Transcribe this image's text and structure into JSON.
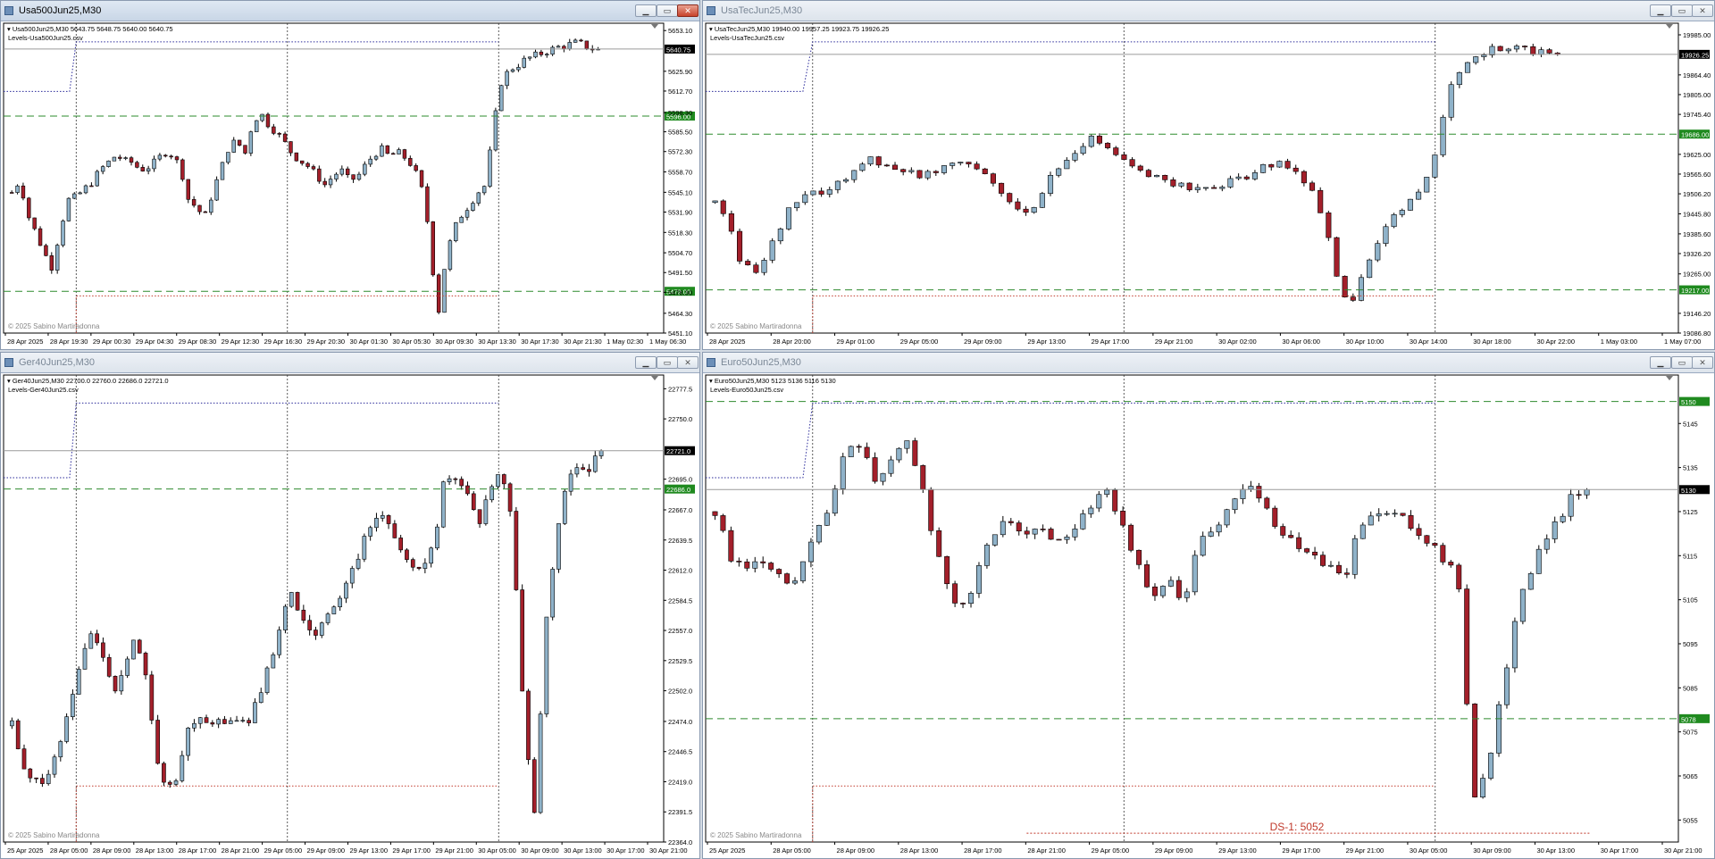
{
  "windows": [
    {
      "title": "Usa500Jun25,M30",
      "active": true,
      "info": "Usa500Jun25,M30  5643.75 5648.75 5640.00 5640.75",
      "indicator": "Levels-Usa500Jun25.csv",
      "copyright": "© 2025 Sabino Martiradonna",
      "buttons": [
        "▁",
        "▭",
        "✕"
      ]
    },
    {
      "title": "UsaTecJun25,M30",
      "active": false,
      "info": "UsaTecJun25,M30  19940.00 19957.25 19923.75 19926.25",
      "indicator": "Levels-UsaTecJun25.csv",
      "copyright": "© 2025 Sabino Martiradonna",
      "buttons": [
        "▁",
        "▭",
        "✕"
      ]
    },
    {
      "title": "Ger40Jun25,M30",
      "active": false,
      "info": "Ger40Jun25,M30  22700.0 22760.0 22686.0 22721.0",
      "indicator": "Levels-Ger40Jun25.csv",
      "copyright": "© 2025 Sabino Martiradonna",
      "buttons": [
        "▁",
        "▭",
        "✕"
      ]
    },
    {
      "title": "Euro50Jun25,M30",
      "active": false,
      "info": "Euro50Jun25,M30  5123 5136 5116 5130",
      "indicator": "Levels-Euro50Jun25.csv",
      "copyright": "© 2025 Sabino Martiradonna",
      "buttons": [
        "▁",
        "▭",
        "✕"
      ]
    }
  ],
  "colors": {
    "bull_fill": "#8fb2c9",
    "bear_fill": "#a31f2a",
    "candle_outline": "#000000",
    "level_line": "#2e8b2e",
    "level_label_bg": "#1f8a1f",
    "price_label_bg": "#000000",
    "grid_sep": "#333333",
    "bid_line": "#9a9a9a",
    "ds_line": "#c0392b",
    "blue_dotted": "#2a2a9a"
  },
  "chart_data": [
    {
      "type": "candlestick",
      "symbol": "Usa500Jun25",
      "timeframe": "M30",
      "ylim": [
        5451.1,
        5658.0
      ],
      "y_ticks": [
        "5653.10",
        "5640.75",
        "5625.90",
        "5612.70",
        "5598.30",
        "5585.50",
        "5572.30",
        "5558.70",
        "5545.10",
        "5531.90",
        "5518.30",
        "5504.70",
        "5491.50",
        "5478.30",
        "5464.30",
        "5451.10"
      ],
      "x_tick_labels": [
        "28 Apr 2025",
        "28 Apr 19:30",
        "29 Apr 00:30",
        "29 Apr 04:30",
        "29 Apr 08:30",
        "29 Apr 12:30",
        "29 Apr 16:30",
        "29 Apr 20:30",
        "30 Apr 01:30",
        "30 Apr 05:30",
        "30 Apr 09:30",
        "30 Apr 13:30",
        "30 Apr 17:30",
        "30 Apr 21:30",
        "1 May 02:30",
        "1 May 06:30"
      ],
      "current_price": "5640.75",
      "levels": [
        {
          "value": 5596.0,
          "label": "5596.00"
        },
        {
          "value": 5479.0,
          "label": "5479.00"
        }
      ],
      "n_candles": 104,
      "path": [
        5545,
        5553,
        5530,
        5518,
        5505,
        5495,
        5520,
        5540,
        5542,
        5547,
        5552,
        5560,
        5565,
        5570,
        5566,
        5565,
        5560,
        5562,
        5566,
        5572,
        5570,
        5562,
        5540,
        5535,
        5528,
        5545,
        5560,
        5575,
        5580,
        5570,
        5592,
        5598,
        5590,
        5585,
        5578,
        5570,
        5566,
        5562,
        5556,
        5550,
        5556,
        5560,
        5553,
        5555,
        5563,
        5570,
        5574,
        5569,
        5572,
        5568,
        5562,
        5548,
        5518,
        5460,
        5500,
        5520,
        5530,
        5537,
        5545,
        5550,
        5590,
        5620,
        5627,
        5630,
        5634,
        5636,
        5638,
        5640,
        5642,
        5643,
        5645,
        5644,
        5641,
        5640.75
      ],
      "xmax_frac": 0.905
    },
    {
      "type": "candlestick",
      "symbol": "UsaTecJun25",
      "timeframe": "M30",
      "ylim": [
        19086.8,
        20020.0
      ],
      "y_ticks": [
        "19985.00",
        "19926.25",
        "19864.40",
        "19805.00",
        "19745.40",
        "19686.00",
        "19625.00",
        "19565.60",
        "19506.20",
        "19445.80",
        "19385.60",
        "19326.20",
        "19265.00",
        "19217.00",
        "19146.20",
        "19086.80"
      ],
      "x_tick_labels": [
        "28 Apr 2025",
        "28 Apr 20:00",
        "29 Apr 01:00",
        "29 Apr 05:00",
        "29 Apr 09:00",
        "29 Apr 13:00",
        "29 Apr 17:00",
        "29 Apr 21:00",
        "30 Apr 02:00",
        "30 Apr 06:00",
        "30 Apr 10:00",
        "30 Apr 14:00",
        "30 Apr 18:00",
        "30 Apr 22:00",
        "1 May 03:00",
        "1 May 07:00"
      ],
      "current_price": "19926.25",
      "levels": [
        {
          "value": 19686.0,
          "label": "19686.00"
        },
        {
          "value": 19217.0,
          "label": "19217.00"
        }
      ],
      "n_candles": 104,
      "path": [
        19480,
        19430,
        19300,
        19270,
        19320,
        19400,
        19480,
        19510,
        19500,
        19530,
        19550,
        19590,
        19610,
        19600,
        19580,
        19570,
        19560,
        19580,
        19600,
        19610,
        19590,
        19560,
        19520,
        19470,
        19440,
        19500,
        19560,
        19600,
        19640,
        19670,
        19650,
        19620,
        19590,
        19570,
        19560,
        19545,
        19530,
        19520,
        19525,
        19530,
        19545,
        19560,
        19580,
        19590,
        19595,
        19570,
        19520,
        19420,
        19250,
        19150,
        19280,
        19340,
        19420,
        19460,
        19500,
        19560,
        19700,
        19860,
        19910,
        19930,
        19940,
        19945,
        19944,
        19935,
        19930,
        19926.25
      ],
      "xmax_frac": 0.88
    },
    {
      "type": "candlestick",
      "symbol": "Ger40Jun25",
      "timeframe": "M30",
      "ylim": [
        22364.0,
        22790.0
      ],
      "y_ticks": [
        "22777.5",
        "22750.0",
        "22721.0",
        "22695.0",
        "22686.0",
        "22667.0",
        "22639.5",
        "22612.0",
        "22584.5",
        "22557.0",
        "22529.5",
        "22502.0",
        "22474.0",
        "22446.5",
        "22419.0",
        "22391.5",
        "22364.0"
      ],
      "x_tick_labels": [
        "25 Apr 2025",
        "28 Apr 05:00",
        "28 Apr 09:00",
        "28 Apr 13:00",
        "28 Apr 17:00",
        "28 Apr 21:00",
        "29 Apr 05:00",
        "29 Apr 09:00",
        "29 Apr 13:00",
        "29 Apr 17:00",
        "29 Apr 21:00",
        "30 Apr 05:00",
        "30 Apr 09:00",
        "30 Apr 13:00",
        "30 Apr 17:00",
        "30 Apr 21:00"
      ],
      "current_price": "22721.0",
      "levels": [
        {
          "value": 22686.0,
          "label": "22686.0"
        }
      ],
      "n_candles": 98,
      "path": [
        22470,
        22430,
        22415,
        22425,
        22440,
        22480,
        22520,
        22560,
        22540,
        22500,
        22520,
        22555,
        22520,
        22440,
        22410,
        22430,
        22470,
        22480,
        22470,
        22475,
        22480,
        22470,
        22490,
        22520,
        22560,
        22590,
        22570,
        22550,
        22560,
        22580,
        22600,
        22620,
        22650,
        22660,
        22650,
        22630,
        22620,
        22610,
        22640,
        22700,
        22690,
        22680,
        22650,
        22690,
        22700,
        22660,
        22480,
        22390,
        22560,
        22640,
        22700,
        22710,
        22705,
        22721
      ],
      "xmax_frac": 0.91
    },
    {
      "type": "candlestick",
      "symbol": "Euro50Jun25",
      "timeframe": "M30",
      "ylim": [
        5050,
        5156
      ],
      "y_ticks": [
        "5150",
        "5145",
        "5135",
        "5130",
        "5125",
        "5115",
        "5105",
        "5095",
        "5085",
        "5078",
        "5075",
        "5065",
        "5055"
      ],
      "x_tick_labels": [
        "25 Apr 2025",
        "28 Apr 05:00",
        "28 Apr 09:00",
        "28 Apr 13:00",
        "28 Apr 17:00",
        "28 Apr 21:00",
        "29 Apr 05:00",
        "29 Apr 09:00",
        "29 Apr 13:00",
        "29 Apr 17:00",
        "29 Apr 21:00",
        "30 Apr 05:00",
        "30 Apr 09:00",
        "30 Apr 13:00",
        "30 Apr 17:00",
        "30 Apr 21:00"
      ],
      "current_price": "5130",
      "levels": [
        {
          "value": 5150,
          "label": "5150"
        },
        {
          "value": 5078,
          "label": "5078"
        }
      ],
      "annotation": "DS-1: 5052",
      "ds_level": 5052,
      "n_candles": 110,
      "path": [
        5125,
        5115,
        5113,
        5112,
        5110,
        5108,
        5118,
        5125,
        5138,
        5140,
        5132,
        5138,
        5140,
        5128,
        5112,
        5103,
        5108,
        5120,
        5122,
        5120,
        5121,
        5119,
        5118,
        5125,
        5130,
        5125,
        5115,
        5105,
        5110,
        5105,
        5118,
        5122,
        5128,
        5130,
        5128,
        5120,
        5118,
        5116,
        5113,
        5110,
        5122,
        5124,
        5126,
        5122,
        5118,
        5115,
        5112,
        5060,
        5068,
        5090,
        5108,
        5116,
        5122,
        5128,
        5130
      ],
      "xmax_frac": 0.91
    }
  ]
}
